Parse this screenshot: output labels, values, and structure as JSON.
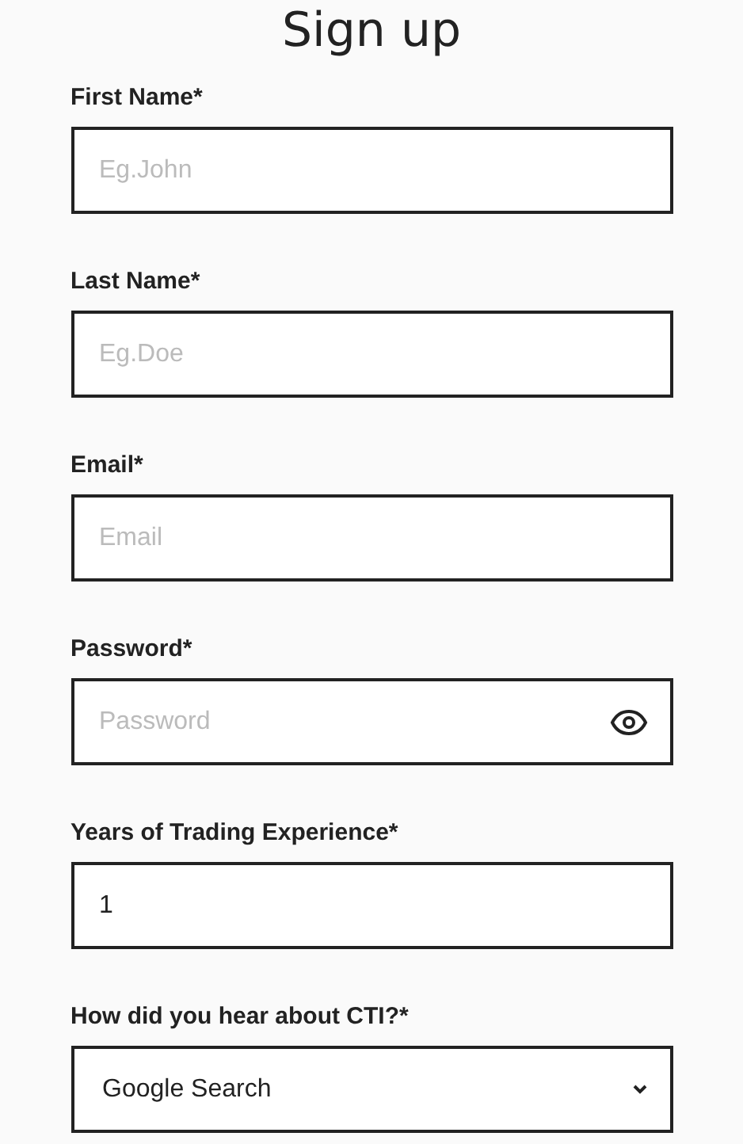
{
  "title": "Sign up",
  "fields": [
    {
      "kind": "text",
      "label": "First Name*",
      "placeholder": "Eg.John"
    },
    {
      "kind": "text",
      "label": "Last Name*",
      "placeholder": "Eg.Doe"
    },
    {
      "kind": "text",
      "label": "Email*",
      "placeholder": "Email"
    },
    {
      "kind": "password",
      "label": "Password*",
      "placeholder": "Password"
    },
    {
      "kind": "text",
      "label": "Years of Trading Experience*",
      "value": "1"
    },
    {
      "kind": "select",
      "label": "How did you hear about CTI?*",
      "value": "Google Search"
    }
  ]
}
